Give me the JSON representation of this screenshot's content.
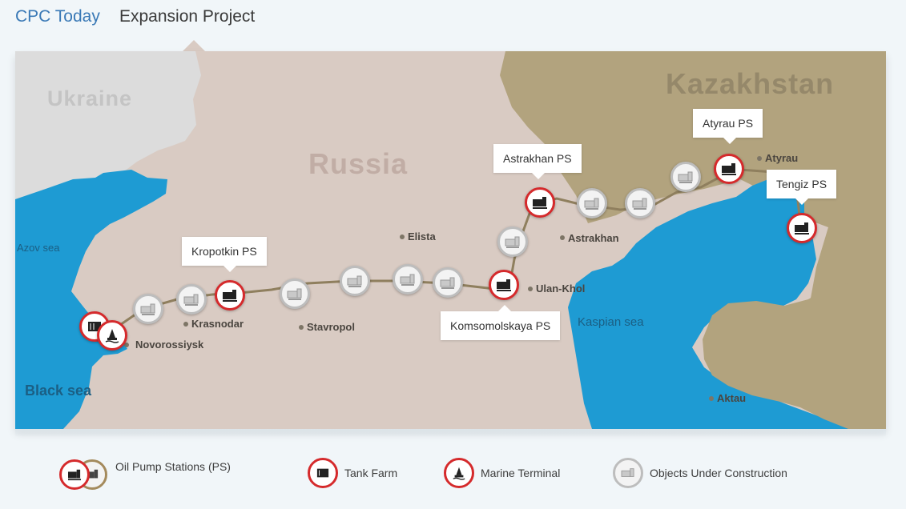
{
  "tabs": [
    {
      "label": "CPC Today"
    },
    {
      "label": "Expansion Project"
    }
  ],
  "map": {
    "countries": {
      "ukraine": "Ukraine",
      "russia": "Russia",
      "kazakhstan": "Kazakhstan"
    },
    "seas": {
      "azov": "Azov sea",
      "black": "Black sea",
      "caspian": "Kaspian sea"
    },
    "cities": {
      "novorossiysk": "Novorossiysk",
      "krasnodar": "Krasnodar",
      "stavropol": "Stavropol",
      "elista": "Elista",
      "ulan_khol": "Ulan-Khol",
      "astrakhan": "Astrakhan",
      "atyrau": "Atyrau",
      "aktau": "Aktau"
    },
    "callouts": {
      "kropotkin": "Kropotkin PS",
      "komsomolskaya": "Komsomolskaya PS",
      "astrakhan": "Astrakhan PS",
      "atyrau": "Atyrau PS",
      "tengiz": "Tengiz PS"
    },
    "colors": {
      "land_russia": "#d9cbc3",
      "land_kazakhstan": "#b2a37e",
      "land_ukraine": "#dcdcdc",
      "sea": "#1e9bd3",
      "pipeline": "#8f7f5e",
      "active_border": "#d52a2c",
      "construction_border": "#bdbdbd"
    },
    "icons": {
      "pump": "pump-station-icon",
      "tank": "tank-farm-icon",
      "marine": "marine-terminal-icon",
      "construction": "construction-icon"
    }
  },
  "legend": {
    "pump_stations": "Oil Pump Stations (PS)",
    "tank_farm": "Tank Farm",
    "marine_terminal": "Marine Terminal",
    "under_construction": "Objects Under Construction"
  }
}
